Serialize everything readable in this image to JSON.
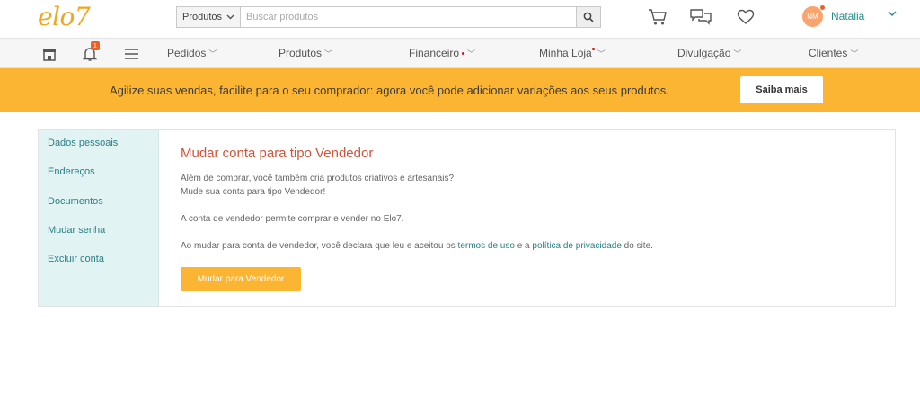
{
  "header": {
    "logo": "elo7",
    "search": {
      "category": "Produtos",
      "placeholder": "Buscar produtos"
    },
    "user": {
      "initials": "NM",
      "name": "Natalia"
    }
  },
  "nav": {
    "notification_count": "1",
    "items": [
      {
        "label": "Pedidos"
      },
      {
        "label": "Produtos"
      },
      {
        "label": "Financeiro"
      },
      {
        "label": "Minha Loja"
      },
      {
        "label": "Divulgação"
      },
      {
        "label": "Clientes"
      }
    ]
  },
  "banner": {
    "text": "Agilize suas vendas, facilite para o seu comprador: agora você pode adicionar variações aos seus produtos.",
    "button": "Saiba mais"
  },
  "sidebar": {
    "items": [
      {
        "label": "Dados pessoais"
      },
      {
        "label": "Endereços"
      },
      {
        "label": "Documentos"
      },
      {
        "label": "Mudar senha"
      },
      {
        "label": "Excluir conta"
      }
    ]
  },
  "main": {
    "title": "Mudar conta para tipo Vendedor",
    "line1": "Além de comprar, você também cria produtos criativos e artesanais?",
    "line2": "Mude sua conta para tipo Vendedor!",
    "line3": "A conta de vendedor permite comprar e vender no Elo7.",
    "line4_a": "Ao mudar para conta de vendedor, você declara que leu e aceitou os ",
    "link_terms": "termos de uso",
    "line4_b": " e a ",
    "link_privacy": "política de privacidade",
    "line4_c": " do site.",
    "button": "Mudar para Vendedor"
  },
  "colors": {
    "accent": "#fcb533",
    "logo": "#f3a51c",
    "title": "#d2533a",
    "link": "#2a7f86",
    "sidebar_bg": "#e2f3f3"
  }
}
